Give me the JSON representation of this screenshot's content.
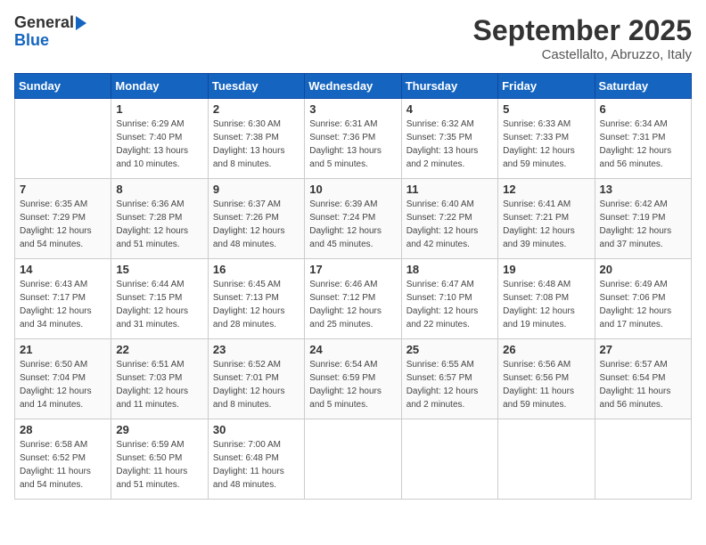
{
  "logo": {
    "general": "General",
    "blue": "Blue"
  },
  "title": "September 2025",
  "subtitle": "Castellalto, Abruzzo, Italy",
  "days_header": [
    "Sunday",
    "Monday",
    "Tuesday",
    "Wednesday",
    "Thursday",
    "Friday",
    "Saturday"
  ],
  "weeks": [
    [
      {
        "day": "",
        "detail": ""
      },
      {
        "day": "1",
        "detail": "Sunrise: 6:29 AM\nSunset: 7:40 PM\nDaylight: 13 hours\nand 10 minutes."
      },
      {
        "day": "2",
        "detail": "Sunrise: 6:30 AM\nSunset: 7:38 PM\nDaylight: 13 hours\nand 8 minutes."
      },
      {
        "day": "3",
        "detail": "Sunrise: 6:31 AM\nSunset: 7:36 PM\nDaylight: 13 hours\nand 5 minutes."
      },
      {
        "day": "4",
        "detail": "Sunrise: 6:32 AM\nSunset: 7:35 PM\nDaylight: 13 hours\nand 2 minutes."
      },
      {
        "day": "5",
        "detail": "Sunrise: 6:33 AM\nSunset: 7:33 PM\nDaylight: 12 hours\nand 59 minutes."
      },
      {
        "day": "6",
        "detail": "Sunrise: 6:34 AM\nSunset: 7:31 PM\nDaylight: 12 hours\nand 56 minutes."
      }
    ],
    [
      {
        "day": "7",
        "detail": "Sunrise: 6:35 AM\nSunset: 7:29 PM\nDaylight: 12 hours\nand 54 minutes."
      },
      {
        "day": "8",
        "detail": "Sunrise: 6:36 AM\nSunset: 7:28 PM\nDaylight: 12 hours\nand 51 minutes."
      },
      {
        "day": "9",
        "detail": "Sunrise: 6:37 AM\nSunset: 7:26 PM\nDaylight: 12 hours\nand 48 minutes."
      },
      {
        "day": "10",
        "detail": "Sunrise: 6:39 AM\nSunset: 7:24 PM\nDaylight: 12 hours\nand 45 minutes."
      },
      {
        "day": "11",
        "detail": "Sunrise: 6:40 AM\nSunset: 7:22 PM\nDaylight: 12 hours\nand 42 minutes."
      },
      {
        "day": "12",
        "detail": "Sunrise: 6:41 AM\nSunset: 7:21 PM\nDaylight: 12 hours\nand 39 minutes."
      },
      {
        "day": "13",
        "detail": "Sunrise: 6:42 AM\nSunset: 7:19 PM\nDaylight: 12 hours\nand 37 minutes."
      }
    ],
    [
      {
        "day": "14",
        "detail": "Sunrise: 6:43 AM\nSunset: 7:17 PM\nDaylight: 12 hours\nand 34 minutes."
      },
      {
        "day": "15",
        "detail": "Sunrise: 6:44 AM\nSunset: 7:15 PM\nDaylight: 12 hours\nand 31 minutes."
      },
      {
        "day": "16",
        "detail": "Sunrise: 6:45 AM\nSunset: 7:13 PM\nDaylight: 12 hours\nand 28 minutes."
      },
      {
        "day": "17",
        "detail": "Sunrise: 6:46 AM\nSunset: 7:12 PM\nDaylight: 12 hours\nand 25 minutes."
      },
      {
        "day": "18",
        "detail": "Sunrise: 6:47 AM\nSunset: 7:10 PM\nDaylight: 12 hours\nand 22 minutes."
      },
      {
        "day": "19",
        "detail": "Sunrise: 6:48 AM\nSunset: 7:08 PM\nDaylight: 12 hours\nand 19 minutes."
      },
      {
        "day": "20",
        "detail": "Sunrise: 6:49 AM\nSunset: 7:06 PM\nDaylight: 12 hours\nand 17 minutes."
      }
    ],
    [
      {
        "day": "21",
        "detail": "Sunrise: 6:50 AM\nSunset: 7:04 PM\nDaylight: 12 hours\nand 14 minutes."
      },
      {
        "day": "22",
        "detail": "Sunrise: 6:51 AM\nSunset: 7:03 PM\nDaylight: 12 hours\nand 11 minutes."
      },
      {
        "day": "23",
        "detail": "Sunrise: 6:52 AM\nSunset: 7:01 PM\nDaylight: 12 hours\nand 8 minutes."
      },
      {
        "day": "24",
        "detail": "Sunrise: 6:54 AM\nSunset: 6:59 PM\nDaylight: 12 hours\nand 5 minutes."
      },
      {
        "day": "25",
        "detail": "Sunrise: 6:55 AM\nSunset: 6:57 PM\nDaylight: 12 hours\nand 2 minutes."
      },
      {
        "day": "26",
        "detail": "Sunrise: 6:56 AM\nSunset: 6:56 PM\nDaylight: 11 hours\nand 59 minutes."
      },
      {
        "day": "27",
        "detail": "Sunrise: 6:57 AM\nSunset: 6:54 PM\nDaylight: 11 hours\nand 56 minutes."
      }
    ],
    [
      {
        "day": "28",
        "detail": "Sunrise: 6:58 AM\nSunset: 6:52 PM\nDaylight: 11 hours\nand 54 minutes."
      },
      {
        "day": "29",
        "detail": "Sunrise: 6:59 AM\nSunset: 6:50 PM\nDaylight: 11 hours\nand 51 minutes."
      },
      {
        "day": "30",
        "detail": "Sunrise: 7:00 AM\nSunset: 6:48 PM\nDaylight: 11 hours\nand 48 minutes."
      },
      {
        "day": "",
        "detail": ""
      },
      {
        "day": "",
        "detail": ""
      },
      {
        "day": "",
        "detail": ""
      },
      {
        "day": "",
        "detail": ""
      }
    ]
  ]
}
